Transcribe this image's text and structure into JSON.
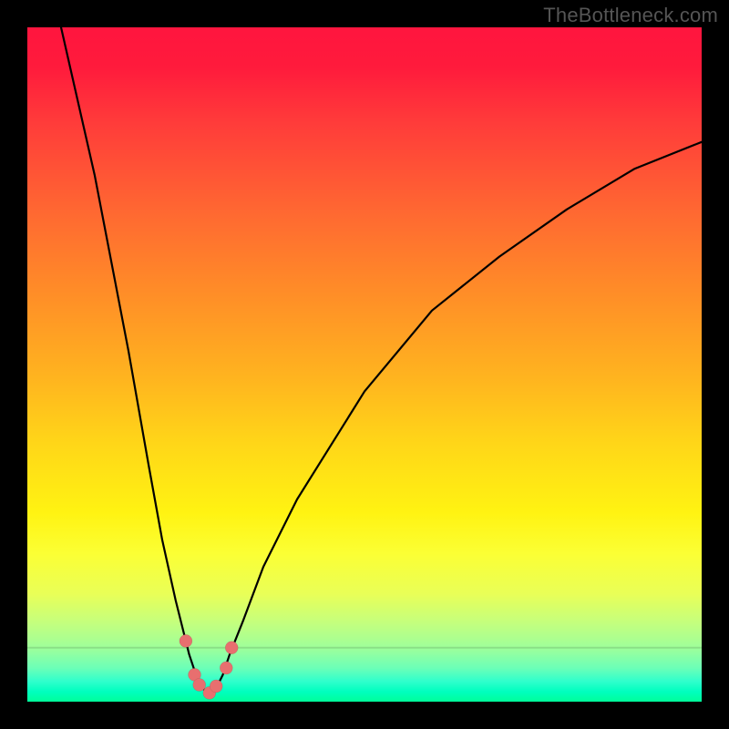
{
  "watermark": "TheBottleneck.com",
  "colors": {
    "page_bg": "#000000",
    "gradient_top": "#ff153e",
    "gradient_mid": "#ffd718",
    "gradient_bottom": "#00ff99",
    "curve": "#000000",
    "dots": "#e86f6f"
  },
  "chart_data": {
    "type": "line",
    "title": "",
    "xlabel": "",
    "ylabel": "",
    "xlim": [
      0,
      100
    ],
    "ylim": [
      0,
      100
    ],
    "note": "Bottleneck-style V curve; y ≈ percent bottleneck, minimum near x≈27. Values estimated from pixels (no axis ticks shown).",
    "series": [
      {
        "name": "bottleneck-curve",
        "x": [
          5,
          10,
          15,
          18,
          20,
          22,
          24,
          25,
          26,
          27,
          28,
          29,
          30,
          32,
          35,
          40,
          50,
          60,
          70,
          80,
          90,
          100
        ],
        "y": [
          100,
          78,
          52,
          35,
          24,
          15,
          7,
          4,
          2,
          1,
          2,
          4,
          7,
          12,
          20,
          30,
          46,
          58,
          66,
          73,
          79,
          83
        ]
      }
    ],
    "markers": [
      {
        "x": 23.5,
        "y": 9
      },
      {
        "x": 24.8,
        "y": 4
      },
      {
        "x": 25.5,
        "y": 2.5
      },
      {
        "x": 27.0,
        "y": 1.3
      },
      {
        "x": 28.0,
        "y": 2.3
      },
      {
        "x": 29.5,
        "y": 5
      },
      {
        "x": 30.3,
        "y": 8
      }
    ]
  }
}
